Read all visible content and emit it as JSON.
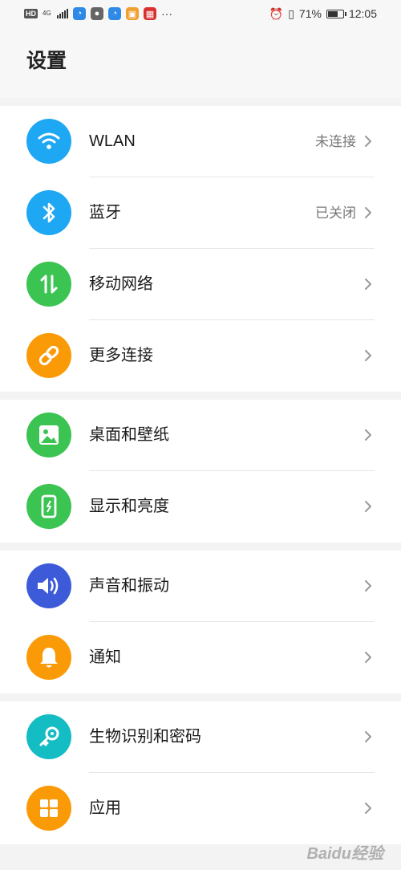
{
  "status_bar": {
    "hd": "HD",
    "net": "4G",
    "battery_percent": "71%",
    "time": "12:05",
    "more": "···",
    "battery_level": 0.71
  },
  "header": {
    "title": "设置"
  },
  "sections": [
    {
      "items": [
        {
          "label": "WLAN",
          "value": "未连接",
          "icon": "wifi-icon",
          "color": "#1ea7f2"
        },
        {
          "label": "蓝牙",
          "value": "已关闭",
          "icon": "bluetooth-icon",
          "color": "#1ea7f2"
        },
        {
          "label": "移动网络",
          "value": "",
          "icon": "mobile-data-icon",
          "color": "#3bc452"
        },
        {
          "label": "更多连接",
          "value": "",
          "icon": "link-icon",
          "color": "#fb9a07"
        }
      ]
    },
    {
      "items": [
        {
          "label": "桌面和壁纸",
          "value": "",
          "icon": "wallpaper-icon",
          "color": "#3bc452"
        },
        {
          "label": "显示和亮度",
          "value": "",
          "icon": "display-icon",
          "color": "#3bc452"
        }
      ]
    },
    {
      "items": [
        {
          "label": "声音和振动",
          "value": "",
          "icon": "sound-icon",
          "color": "#3d5bd9"
        },
        {
          "label": "通知",
          "value": "",
          "icon": "bell-icon",
          "color": "#fb9a07"
        }
      ]
    },
    {
      "items": [
        {
          "label": "生物识别和密码",
          "value": "",
          "icon": "key-icon",
          "color": "#14bcc4"
        },
        {
          "label": "应用",
          "value": "",
          "icon": "apps-icon",
          "color": "#fb9a07"
        }
      ]
    }
  ],
  "watermark": "Baidu经验"
}
